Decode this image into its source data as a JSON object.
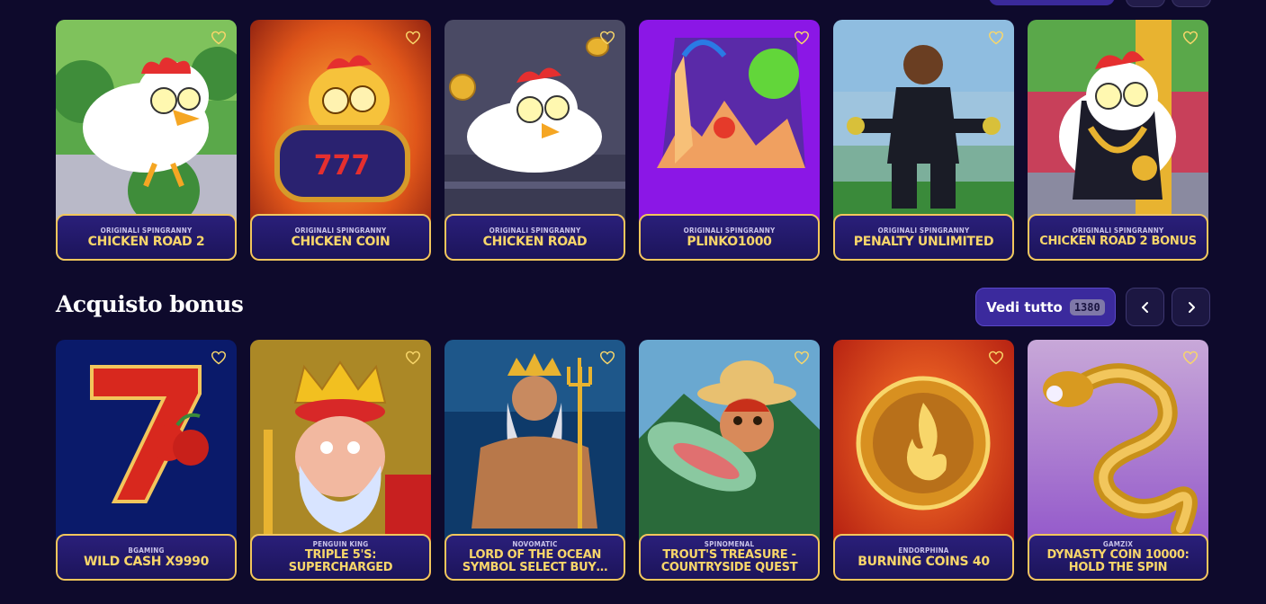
{
  "section1": {
    "cards": [
      {
        "provider": "Originali Spingranny",
        "title": "Chicken Road 2",
        "icon": "chicken-road-2-art"
      },
      {
        "provider": "Originali Spingranny",
        "title": "Chicken Coin",
        "icon": "chicken-coin-art"
      },
      {
        "provider": "Originali Spingranny",
        "title": "Chicken Road",
        "icon": "chicken-road-art"
      },
      {
        "provider": "Originali Spingranny",
        "title": "Plinko1000",
        "icon": "plinko-art"
      },
      {
        "provider": "Originali Spingranny",
        "title": "Penalty Unlimited",
        "icon": "penalty-art"
      },
      {
        "provider": "Originali Spingranny",
        "title": "Chicken Road 2 Bonus",
        "icon": "chicken-road-2-bonus-art"
      }
    ]
  },
  "section2": {
    "title": "Acquisto bonus",
    "view_all_label": "Vedi tutto",
    "count": "1380",
    "cards": [
      {
        "provider": "BGaming",
        "title": "Wild Cash x9990",
        "icon": "lucky-seven-art"
      },
      {
        "provider": "Penguin King",
        "title": "Triple 5's: Supercharged",
        "icon": "king-art"
      },
      {
        "provider": "Novomatic",
        "title": "Lord of the Ocean Symbol Select Buy…",
        "icon": "poseidon-art"
      },
      {
        "provider": "Spinomenal",
        "title": "Trout's Treasure - Countryside Quest",
        "icon": "fisherman-art"
      },
      {
        "provider": "Endorphina",
        "title": "Burning Coins 40",
        "icon": "gold-coin-art"
      },
      {
        "provider": "Gamzix",
        "title": "Dynasty Coin 10000: Hold the Spin",
        "icon": "dragon-art"
      }
    ]
  },
  "colors": {
    "background": "#0e0a2c",
    "label_border": "#f2c65c",
    "title_text": "#f8d66a",
    "button": "#3b2a9d"
  }
}
